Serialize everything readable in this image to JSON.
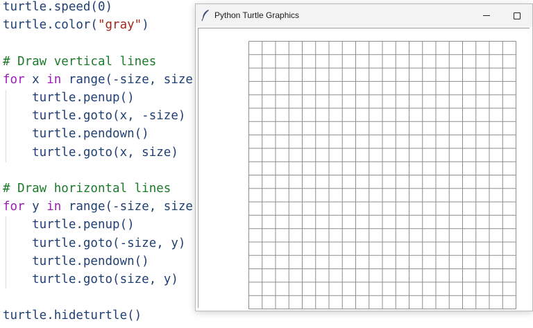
{
  "editor": {
    "colors": {
      "plain": "#1f3f73",
      "keyword": "#9b1fb4",
      "string": "#a3281a",
      "comment": "#1c7a2b"
    },
    "lines": [
      [
        {
          "t": "turtle.speed(0)",
          "c": "plain"
        }
      ],
      [
        {
          "t": "turtle.color(",
          "c": "plain"
        },
        {
          "t": "\"gray\"",
          "c": "str"
        },
        {
          "t": ")",
          "c": "plain"
        }
      ],
      [],
      [
        {
          "t": "# Draw vertical lines",
          "c": "comment"
        }
      ],
      [
        {
          "t": "for",
          "c": "kw"
        },
        {
          "t": " x ",
          "c": "plain"
        },
        {
          "t": "in",
          "c": "kw"
        },
        {
          "t": " range(-size, size",
          "c": "plain"
        }
      ],
      [
        {
          "t": "    turtle.penup()",
          "c": "plain"
        }
      ],
      [
        {
          "t": "    turtle.goto(x, -size)",
          "c": "plain"
        }
      ],
      [
        {
          "t": "    turtle.pendown()",
          "c": "plain"
        }
      ],
      [
        {
          "t": "    turtle.goto(x, size)",
          "c": "plain"
        }
      ],
      [],
      [
        {
          "t": "# Draw horizontal lines",
          "c": "comment"
        }
      ],
      [
        {
          "t": "for",
          "c": "kw"
        },
        {
          "t": " y ",
          "c": "plain"
        },
        {
          "t": "in",
          "c": "kw"
        },
        {
          "t": " range(-size, size",
          "c": "plain"
        }
      ],
      [
        {
          "t": "    turtle.penup()",
          "c": "plain"
        }
      ],
      [
        {
          "t": "    turtle.goto(-size, y)",
          "c": "plain"
        }
      ],
      [
        {
          "t": "    turtle.pendown()",
          "c": "plain"
        }
      ],
      [
        {
          "t": "    turtle.goto(size, y)",
          "c": "plain"
        }
      ],
      [],
      [
        {
          "t": "turtle.hideturtle()",
          "c": "plain"
        }
      ]
    ]
  },
  "window": {
    "title": "Python Turtle Graphics",
    "app_icon": "feather-icon",
    "controls": [
      "minimize-icon",
      "maximize-icon"
    ]
  },
  "canvas": {
    "background": "#ffffff",
    "line_color": "#8c8c8c",
    "grid_columns": 20,
    "grid_rows": 20
  }
}
